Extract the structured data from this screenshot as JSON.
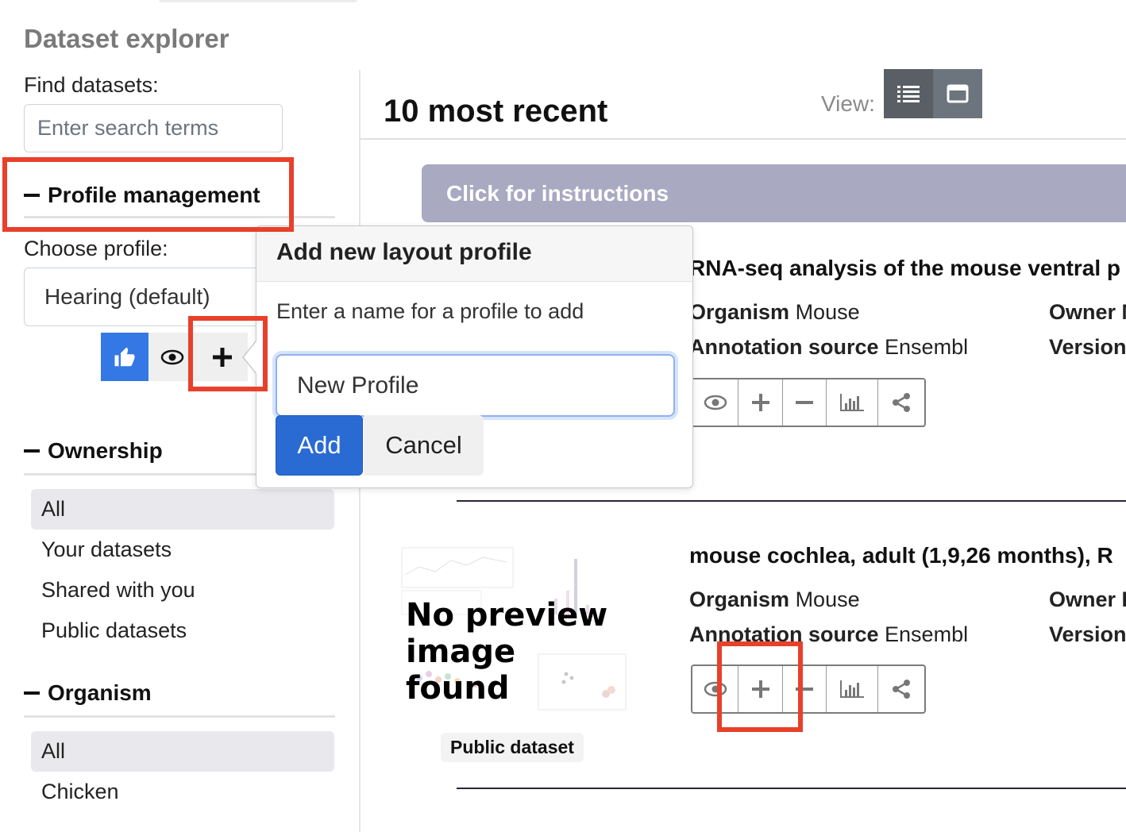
{
  "sidebar": {
    "title": "Dataset explorer",
    "find_label": "Find datasets:",
    "search_placeholder": "Enter search terms",
    "profile_header": "Profile management",
    "choose_profile_label": "Choose profile:",
    "selected_profile": "Hearing (default)",
    "profile_buttons": [
      {
        "name": "like",
        "icon": "thumbs-up-icon"
      },
      {
        "name": "view",
        "icon": "eye-icon"
      },
      {
        "name": "add",
        "icon": "plus-icon"
      }
    ],
    "ownership": {
      "header": "Ownership",
      "items": [
        {
          "label": "All",
          "active": true
        },
        {
          "label": "Your datasets",
          "active": false
        },
        {
          "label": "Shared with you",
          "active": false
        },
        {
          "label": "Public datasets",
          "active": false
        }
      ]
    },
    "organism": {
      "header": "Organism",
      "items": [
        {
          "label": "All",
          "active": true
        },
        {
          "label": "Chicken",
          "active": false
        }
      ]
    }
  },
  "main": {
    "heading": "10 most recent",
    "view_label": "View:",
    "view_modes": [
      {
        "name": "list",
        "icon": "list-icon",
        "active": true
      },
      {
        "name": "card",
        "icon": "window-icon",
        "active": false
      }
    ],
    "instructions_label": "Click for instructions",
    "datasets": [
      {
        "title": "RNA-seq analysis of the mouse ventral p",
        "organism_label": "Organism",
        "organism": "Mouse",
        "annotation_label": "Annotation source",
        "annotation": "Ensembl",
        "owner_label": "Owner",
        "owner": "M",
        "version_label": "Version",
        "tools": [
          "eye-icon",
          "plus-icon",
          "minus-icon",
          "bar-chart-icon",
          "share-icon"
        ]
      },
      {
        "title": "mouse cochlea, adult (1,9,26 months), R",
        "organism_label": "Organism",
        "organism": "Mouse",
        "annotation_label": "Annotation source",
        "annotation": "Ensembl",
        "owner_label": "Owner",
        "owner": "D",
        "version_label": "Version",
        "preview_text": "No preview image found",
        "badge": "Public dataset",
        "tools": [
          "eye-icon",
          "plus-icon",
          "minus-icon",
          "bar-chart-icon",
          "share-icon"
        ]
      }
    ]
  },
  "popover": {
    "title": "Add new layout profile",
    "body": "Enter a name for a profile to add",
    "input_value": "New Profile",
    "add_label": "Add",
    "cancel_label": "Cancel"
  },
  "colors": {
    "primary": "#3478e5",
    "add_button": "#2a6ad3",
    "instructions_bg": "#a9a9c2",
    "highlight": "#e8402a",
    "view_active": "#5a5f66"
  }
}
